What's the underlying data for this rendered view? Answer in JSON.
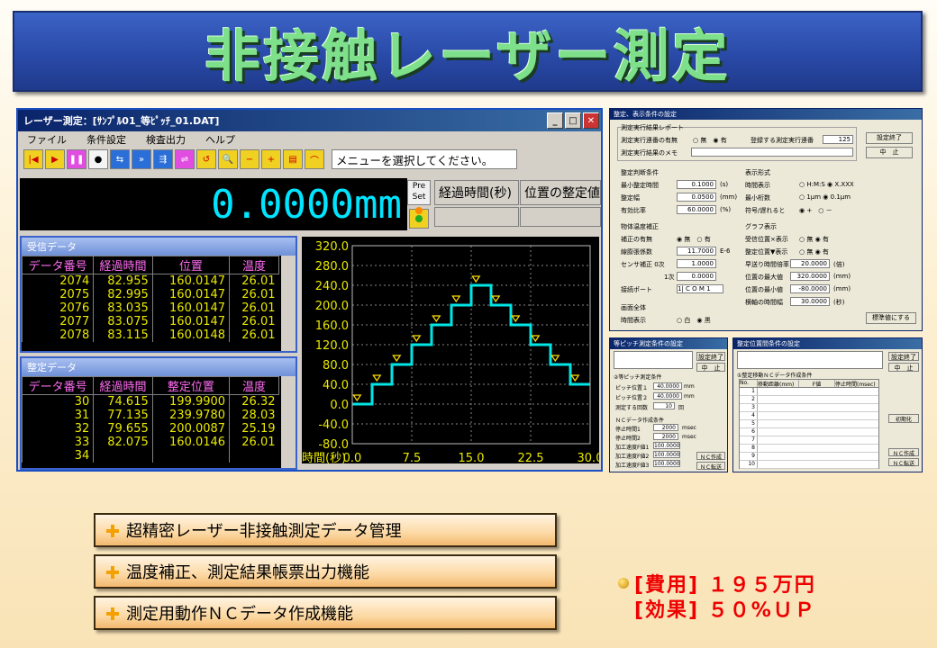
{
  "banner": {
    "title": "非接触レーザー測定"
  },
  "window": {
    "title": "レーザー測定：[ｻﾝﾌﾟﾙ01_等ﾋﾟｯﾁ_01.DAT]",
    "menu": [
      "ファイル",
      "条件設定",
      "検査出力",
      "ヘルプ"
    ],
    "message": "メニューを選択してください。",
    "reading": "0.0000mm",
    "preset_label": "Pre Set",
    "col_elapsed": "経過時間(秒)",
    "col_settle": "位置の整定値"
  },
  "received": {
    "title": "受信データ",
    "headers": [
      "データ番号",
      "経過時間",
      "位置",
      "温度"
    ],
    "rows": [
      [
        "2074",
        "82.955",
        "160.0147",
        "26.01"
      ],
      [
        "2075",
        "82.995",
        "160.0147",
        "26.01"
      ],
      [
        "2076",
        "83.035",
        "160.0147",
        "26.01"
      ],
      [
        "2077",
        "83.075",
        "160.0147",
        "26.01"
      ],
      [
        "2078",
        "83.115",
        "160.0148",
        "26.01"
      ]
    ]
  },
  "settled": {
    "title": "整定データ",
    "headers": [
      "データ番号",
      "経過時間",
      "整定位置",
      "温度"
    ],
    "rows": [
      [
        "30",
        "74.615",
        "199.9900",
        "26.32"
      ],
      [
        "31",
        "77.135",
        "239.9780",
        "28.03"
      ],
      [
        "32",
        "79.655",
        "200.0087",
        "25.19"
      ],
      [
        "33",
        "82.075",
        "160.0146",
        "26.01"
      ],
      [
        "34",
        "",
        "",
        ""
      ]
    ]
  },
  "chart_data": {
    "type": "line",
    "xlabel": "時間(秒)",
    "x_ticks": [
      "0.0",
      "7.5",
      "15.0",
      "22.5",
      "30.0"
    ],
    "y_ticks": [
      "320.0",
      "280.0",
      "240.0",
      "200.0",
      "160.0",
      "120.0",
      "80.0",
      "40.0",
      "0.0",
      "-40.0",
      "-80.0"
    ],
    "xlim": [
      0,
      30
    ],
    "ylim": [
      -80,
      320
    ],
    "x": [
      0,
      2.5,
      5,
      7.5,
      10,
      12.5,
      15,
      17.5,
      20,
      22.5,
      25,
      27.5
    ],
    "values": [
      0,
      40,
      80,
      120,
      160,
      200,
      240,
      200,
      160,
      120,
      80,
      40
    ],
    "series_color": "#00e5e5",
    "marker_color": "#ffe000"
  },
  "settings": {
    "title": "整定、表示条件の設定",
    "report": "測定実行結果レポート",
    "report_exists": "測定実行連番の有無",
    "no": "無",
    "yes": "有",
    "register": "登録する測定実行連番",
    "serial": "125",
    "memo": "測定実行結果のメモ",
    "end_btn": "設定終了",
    "cancel_btn": "中　止",
    "judge": "整定判断条件",
    "min_time": "最小整定時間",
    "min_time_v": "0.1000",
    "min_time_u": "(s)",
    "width": "整定幅",
    "width_v": "0.0500",
    "width_u": "(mm)",
    "ratio": "有効比率",
    "ratio_v": "60.0000",
    "ratio_u": "(%)",
    "fmt": "表示形式",
    "time_disp": "時間表示",
    "hms": "H:M:S",
    "xxx": "X.XXX",
    "digits": "最小桁数",
    "um1": "1μm",
    "um01": "0.1μm",
    "sign": "符号/遅れると",
    "plus": "+",
    "minus": "－",
    "temp": "物体温度補正",
    "temp_has": "補正の有無",
    "coef": "線膨張係数",
    "coef_v": "11.7000",
    "coef_u": "E-6",
    "sensor": "センサ補正 0次",
    "sensor0_v": "1.0000",
    "order1": "1次",
    "sensor1_v": "0.0000",
    "port": "接続ポート",
    "port_v": "1| C O M 1",
    "graph": "グラフ表示",
    "g1": "受信位置×表示",
    "g2": "整定位置▼表示",
    "speed": "早送り時間倍率",
    "speed_v": "20.0000",
    "speed_u": "(倍)",
    "pmax": "位置の最大値",
    "pmax_v": "320.0000",
    "pmax_u": "(mm)",
    "pmin": "位置の最小値",
    "pmin_v": "-80.0000",
    "pmin_u": "(mm)",
    "tw": "横軸の時間幅",
    "tw_v": "30.0000",
    "tw_u": "(秒)",
    "screen": "画面全体",
    "tdisp": "時間表示",
    "white": "白",
    "black": "黒",
    "std_btn": "標準値にする"
  },
  "nc1": {
    "title": "等ピッチ測定条件の設定",
    "end": "設定終了",
    "cancel": "中　止",
    "section": "②等ピッチ測定条件",
    "p1": "ピッチ位置１",
    "p1v": "40.0000",
    "mm": "mm",
    "p2": "ピッチ位置２",
    "p2v": "40.0000",
    "count": "測定する回数",
    "countv": "10",
    "count_u": "回",
    "nc": "ＮＣデータ作成条件",
    "s1": "停止時間1",
    "s1v": "2000",
    "s2": "停止時間2",
    "s2v": "2000",
    "msec": "msec",
    "a1": "加工速度F値1",
    "a1v": "100.0000",
    "a2": "加工速度F値2",
    "a2v": "100.0000",
    "a3": "加工速度F値3",
    "a3v": "100.0000",
    "make": "ＮＣ作成",
    "send": "ＮＣ転送"
  },
  "nc2": {
    "title": "整定位置間条件の設定",
    "end": "設定終了",
    "cancel": "中　止",
    "section": "①整定移動ＮＣデータ作成条件",
    "cols": [
      "No.",
      "移動距離(mm)",
      "F値",
      "停止時間(msec)"
    ],
    "rows": [
      "1",
      "2",
      "3",
      "4",
      "5",
      "6",
      "7",
      "8",
      "9",
      "10"
    ],
    "init": "初期化",
    "make": "ＮＣ作成",
    "send": "ＮＣ転送"
  },
  "features": [
    "超精密レーザー非接触測定データ管理",
    "温度補正、測定結果帳票出力機能",
    "測定用動作ＮＣデータ作成機能"
  ],
  "cost": {
    "line1": "[費用] １９５万円",
    "line2": "[効果] ５０%ＵＰ"
  }
}
